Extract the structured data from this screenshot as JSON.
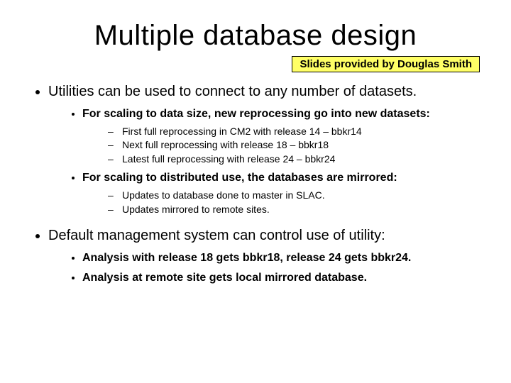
{
  "title": "Multiple database design",
  "attribution": "Slides provided by Douglas Smith",
  "bullets": [
    {
      "text": "Utilities can be used to connect to any number of datasets.",
      "children": [
        {
          "text": "For scaling to data size, new reprocessing go into new datasets:",
          "children": [
            {
              "text": "First full reprocessing in CM2 with release 14 – bbkr14"
            },
            {
              "text": "Next full reprocessing with release 18 – bbkr18"
            },
            {
              "text": "Latest full reprocessing with release 24 – bbkr24"
            }
          ]
        },
        {
          "text": "For scaling to distributed use, the databases are mirrored:",
          "children": [
            {
              "text": "Updates to database done to master in SLAC."
            },
            {
              "text": "Updates mirrored to remote sites."
            }
          ]
        }
      ]
    },
    {
      "text": "Default management system can control use of utility:",
      "children": [
        {
          "text": "Analysis with release 18 gets bbkr18, release 24 gets bbkr24.",
          "children": []
        },
        {
          "text": "Analysis at remote site gets local mirrored database.",
          "children": []
        }
      ]
    }
  ]
}
